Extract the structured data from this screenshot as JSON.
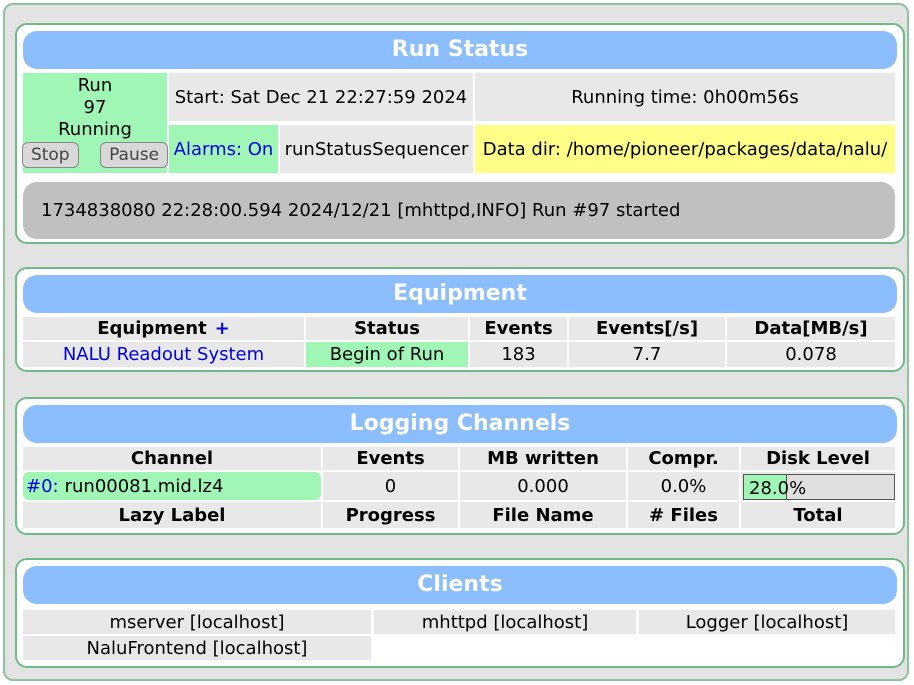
{
  "run_status": {
    "title": "Run Status",
    "run_label": "Run",
    "run_number": "97",
    "state": "Running",
    "stop_label": "Stop",
    "pause_label": "Pause",
    "start": "Start: Sat Dec 21 22:27:59 2024",
    "running_time": "Running time: 0h00m56s",
    "alarms": "Alarms: On",
    "sequencer": "runStatusSequencer",
    "data_dir": "Data dir: /home/pioneer/packages/data/nalu/",
    "message": "1734838080 22:28:00.594 2024/12/21 [mhttpd,INFO] Run #97 started"
  },
  "equipment": {
    "title": "Equipment",
    "headers": {
      "name": "Equipment",
      "add": "+",
      "status": "Status",
      "events": "Events",
      "rate": "Events[/s]",
      "data": "Data[MB/s]"
    },
    "rows": [
      {
        "name": "NALU Readout System",
        "status": "Begin of Run",
        "events": "183",
        "rate": "7.7",
        "data": "0.078"
      }
    ]
  },
  "logging": {
    "title": "Logging Channels",
    "headers": {
      "channel": "Channel",
      "events": "Events",
      "mb_written": "MB written",
      "compr": "Compr.",
      "disk_level": "Disk Level"
    },
    "rows": [
      {
        "index": "#0:",
        "file": "run00081.mid.lz4",
        "events": "0",
        "mb_written": "0.000",
        "compr": "0.0%",
        "disk_level_text": "28.0%",
        "disk_level_fraction": 0.28
      }
    ],
    "lazy_headers": {
      "label": "Lazy Label",
      "progress": "Progress",
      "file_name": "File Name",
      "files": "# Files",
      "total": "Total"
    }
  },
  "clients": {
    "title": "Clients",
    "items": [
      "mserver [localhost]",
      "mhttpd [localhost]",
      "Logger [localhost]",
      "NaluFrontend [localhost]"
    ]
  },
  "colors": {
    "panel_title": "#8cbdff",
    "running": "#a0f6b4",
    "data_dir": "#ffff88",
    "message": "#c0c0c0",
    "link": "#0000dd"
  }
}
